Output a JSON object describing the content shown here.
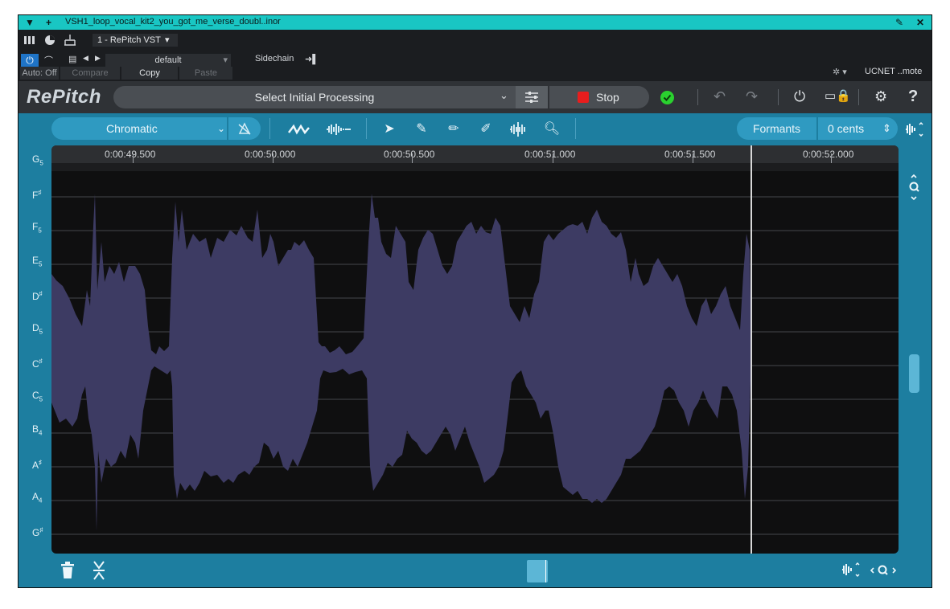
{
  "titlebar": {
    "title": "VSH1_loop_vocal_kit2_you_got_me_verse_doubl..inor",
    "menu_icon": "triangle-down-icon",
    "add_icon": "plus-icon",
    "pin_icon": "pin-icon",
    "close_icon": "close-icon"
  },
  "host": {
    "plugin_slot": "1 - RePitch VST",
    "preset": "default",
    "sidechain": "Sidechain",
    "auto": "Auto: Off",
    "compare": "Compare",
    "copy": "Copy",
    "paste": "Paste",
    "remote": "UCNET ..mote"
  },
  "plugin": {
    "logo": "RePitch",
    "processing": "Select Initial Processing",
    "stop": "Stop",
    "status_color": "#2ad12f"
  },
  "tools": {
    "scale": "Chromatic",
    "formants": "Formants",
    "cents": "0 cents"
  },
  "timeline": {
    "labels": [
      "0:00:49.500",
      "0:00:50.000",
      "0:00:50.500",
      "0:00:51.000",
      "0:00:51.500",
      "0:00:52.000"
    ]
  },
  "notes": {
    "g5": "G",
    "g5o": "5",
    "fs": "F",
    "fss": "♯",
    "f5": "F",
    "f5o": "5",
    "e5": "E",
    "e5o": "5",
    "ds": "D",
    "dss": "♯",
    "d5": "D",
    "d5o": "5",
    "cs": "C",
    "css": "♯",
    "c5": "C",
    "c5o": "5",
    "b4": "B",
    "b4o": "4",
    "as": "A",
    "ass": "♯",
    "a4": "A",
    "a4o": "4",
    "gs": "G",
    "gss": "♯"
  },
  "colors": {
    "accent": "#1d7ea0",
    "waveform": "#3d3b63",
    "titlebar": "#19c6c3",
    "stop_square": "#e81d1d"
  }
}
